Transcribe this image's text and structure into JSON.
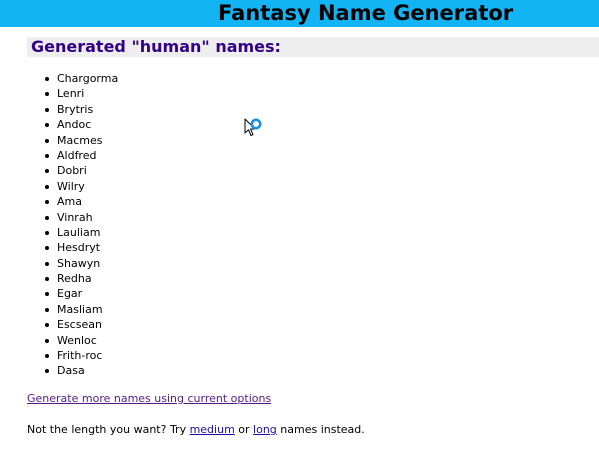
{
  "page": {
    "title": "Fantasy Name Generator",
    "subtitle": "Generated \"human\" names:"
  },
  "names": [
    "Chargorma",
    "Lenri",
    "Brytris",
    "Andoc",
    "Macmes",
    "Aldfred",
    "Dobri",
    "Wilry",
    "Ama",
    "Vinrah",
    "Lauliam",
    "Hesdryt",
    "Shawyn",
    "Redha",
    "Egar",
    "Masliam",
    "Escsean",
    "Wenloc",
    "Frith-roc",
    "Dasa"
  ],
  "links": {
    "generate_more": "Generate more names using current options"
  },
  "length_prompt": {
    "prefix": "Not the length you want? Try ",
    "medium": "medium",
    "middle": " or ",
    "long": "long",
    "suffix": " names instead."
  },
  "colors": {
    "header_bar": "#12b4f3",
    "subheader_bg": "#eeeeee",
    "subheader_text": "#330088",
    "visited_link": "#551a8b",
    "link": "#1a0dab"
  },
  "icons": {
    "cursor": "busy-pointer-icon"
  }
}
